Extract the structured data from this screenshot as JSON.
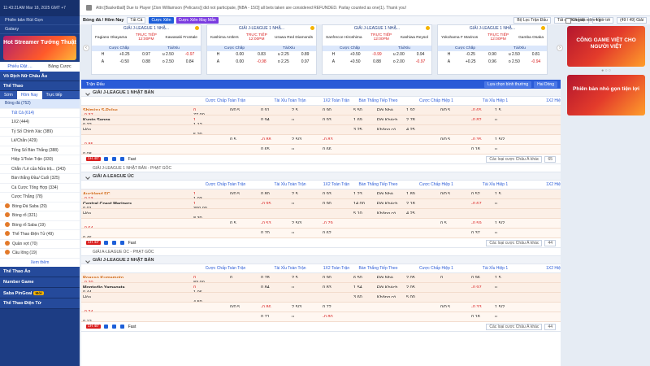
{
  "clock": "11:43:21AM Mar 18, 2025 GMT +7",
  "ticker": "Attn:[Basketball] Due to Player [Zion Williamson (Pelicans)] did not participate, [NBA - 15/3] all bets taken are considered REFUNDED. Parlay counted as one(1). Thank you!",
  "left": {
    "btn1": "Phiên bản Rút Gọn",
    "btn2": "Galaxy",
    "banner": "Hot Streamer Tướng Thuật",
    "tabs": [
      "Phiếu Đặt ...",
      "Bảng Cược"
    ],
    "sec_champions": "Vô Địch Nữ Châu Âu",
    "sec_sports": "Thể Thao",
    "subtabs": [
      "Sớm",
      "Hôm Nay",
      "Trực tiếp"
    ],
    "soccer": "Bóng đá (752)",
    "items": [
      "Tất Cả (614)",
      "1X2 (444)",
      "Tỷ Số Chính Xác (389)",
      "Lẻ/Chẵn (429)",
      "Tổng Số Bàn Thắng (388)",
      "Hiệp 1/Toàn Trận (330)",
      "Chẵn / Lẻ của Nửa trậ... (343)",
      "Bàn thắng Đầu/ Cuối (325)",
      "Cá Cược Tổng Hợp (334)",
      "Cược Thắng (78)"
    ],
    "sports": [
      "Bóng Đá Saba (29)",
      "Bóng rổ (321)",
      "Bóng rổ Saba (19)",
      "Thể Thao Điện Tử (49)",
      "Quần vợt (70)",
      "Cầu lông (19)"
    ],
    "more": "Xem thêm",
    "bottom": [
      "Thể Thao Ảo",
      "Number Game",
      "Saba PinGoal",
      "Thể Thao Điện Tử"
    ],
    "new_badge": "Mới"
  },
  "filter": {
    "title": "Bóng đá / Hôm Nay",
    "all": "Tất Cả",
    "btn_cx": "Cược Xiên",
    "btn_may": "Cược Xiên May Mắn",
    "sort": "Bộ Lọc Trận Đấu",
    "time": "Tất cả thời gian",
    "hours": "4 giờ tới",
    "count": "(49 / 49) Giải"
  },
  "cards": [
    {
      "league": "GIẢI J-LEAGUE 1 NHẬ...",
      "home": "Fagiano Okayama",
      "status": "TRỰC TIẾP",
      "time": "12:00PM",
      "away": "Kawasaki Frontale",
      "h1": [
        "H",
        "+0.25",
        "0.97",
        "u 2.50",
        "-0.97"
      ],
      "h2": [
        "A",
        "-0.50",
        "0.88",
        "o 2.50",
        "0.84"
      ]
    },
    {
      "league": "GIẢI J-LEAGUE 1 NHẬ...",
      "home": "Kashima Antlers",
      "status": "TRỰC TIẾP",
      "time": "12:00PM",
      "away": "Urawa Red Diamonds",
      "h1": [
        "H",
        "0.00",
        "0.83",
        "u 2.25",
        "0.89"
      ],
      "h2": [
        "A",
        "0.00",
        "-0.98",
        "o 2.25",
        "0.97"
      ]
    },
    {
      "league": "GIẢI J-LEAGUE 1 NHẬ...",
      "home": "Sanfrecce Hiroshima",
      "status": "TRỰC TIẾP",
      "time": "12:00PM",
      "away": "Kashiwa Reysol",
      "h1": [
        "H",
        "+0.50",
        "-0.99",
        "u 2.00",
        "0.94"
      ],
      "h2": [
        "A",
        "+0.50",
        "0.88",
        "o 2.00",
        "-0.97"
      ]
    },
    {
      "league": "GIẢI J-LEAGUE 1 NHẬ...",
      "home": "Yokohama F Marinos",
      "status": "TRỰC TIẾP",
      "time": "12:00PM",
      "away": "Gamba Osaka",
      "h1": [
        "H",
        "-0.25",
        "0.90",
        "u 2.50",
        "0.81"
      ],
      "h2": [
        "A",
        "+0.25",
        "0.96",
        "o 2.50",
        "-0.94"
      ]
    }
  ],
  "card_hdr": [
    "Cược Chấp",
    "Tài/Xỉu"
  ],
  "right": {
    "chk": "Chế độ niêm tối",
    "ad1": "CÔNG GAME VIỆT CHO NGƯỜI VIỆT",
    "ad2": "Phiên bản nhỏ gọn tiện lợi"
  },
  "main": {
    "title": "Trận Đấu",
    "btn_sort": "Lựa chọn bình thường",
    "btn_odds": "Hai Dòng"
  },
  "cols": [
    "",
    "",
    "Cược Chấp Toàn Trận",
    "",
    "Tài Xỉu Toàn Trận",
    "",
    "1X2 Toàn Trận",
    "Bàn Thắng Tiếp Theo",
    "",
    "Cược Chấp Hiệp 1",
    "",
    "Tài Xỉu Hiệp 1",
    "",
    "1X2 Hiệp 1"
  ],
  "blocks": [
    {
      "league": "GIẢI J-LEAGUE 1 NHẬT BẢN",
      "home": "Shimizu S-Pulse",
      "away": "Kyoto Sanga",
      "draw": "Hòa",
      "hs": "0",
      "as": "1",
      "r1": [
        "0/0.5",
        "0.91",
        "2.5",
        "0.90",
        "5.50",
        "Đội Nhà",
        "1.92",
        "0/0.5",
        "-0.65",
        "1.5",
        "-0.37",
        "77.00"
      ],
      "r2": [
        "",
        "0.94",
        "u",
        "0.93",
        "1.69",
        "Đội Khách",
        "2.78",
        "",
        "-0.82",
        "u",
        "0.22",
        "1.12"
      ],
      "r3": [
        "",
        "",
        "",
        "",
        "3.25",
        "Không có",
        "4.25",
        "",
        "",
        "",
        "",
        "5.20"
      ],
      "r4": [
        "0.5",
        "-0.88",
        "2.5/3",
        "-0.83",
        "",
        "",
        "",
        "0/0.5",
        "-0.35",
        "1.5/2",
        "-0.85",
        ""
      ],
      "r5": [
        "",
        "0.65",
        "u",
        "0.66",
        "",
        "",
        "",
        "",
        "0.18",
        "u",
        "0.08",
        ""
      ],
      "live": "1H 40'",
      "foot": "Fast",
      "more": "Các loại cược Châu Á khác",
      "n": "65"
    },
    {
      "league": "GIẢI A-LEAGUE ÚC",
      "home": "Auckland FC",
      "away": "Central Coast Mariners",
      "draw": "Hòa",
      "hs": "1",
      "as": "1",
      "r1": [
        "0/0.5",
        "0.80",
        "2.5",
        "0.93",
        "1.23",
        "Đội Nhà",
        "1.89",
        "0/0.5",
        "0.52",
        "1.5",
        "-0.13",
        "1.03"
      ],
      "r2": [
        "",
        "-0.95",
        "u",
        "0.90",
        "14.00",
        "Đội Khách",
        "2.18",
        "",
        "-0.67",
        "u",
        "0.01",
        "300.00"
      ],
      "r3": [
        "",
        "",
        "",
        "",
        "5.10",
        "Không có",
        "4.25",
        "",
        "",
        "",
        "",
        "8.30"
      ],
      "r4": [
        "0.5",
        "-0.53",
        "2.5/3",
        "-0.79",
        "",
        "",
        "",
        "0.5",
        "-0.59",
        "1.5/2",
        "-0.64",
        ""
      ],
      "r5": [
        "",
        "0.70",
        "u",
        "0.62",
        "",
        "",
        "",
        "",
        "0.37",
        "u",
        "0.46",
        ""
      ],
      "live": "1H 43'",
      "foot": "Fast",
      "more": "Các loại cược Châu Á khác",
      "n": "44"
    },
    {
      "league": "GIẢI J-LEAGUE 2 NHẬT BẢN",
      "home": "Roasso Kumamoto",
      "away": "Montedio Yamagata",
      "draw": "Hòa",
      "hs": "0",
      "as": "0",
      "r1": [
        "0",
        "0.78",
        "2.5",
        "0.90",
        "6.50",
        "Đội Nhà",
        "2.05",
        "0",
        "0.96",
        "1.5",
        "-0.70",
        "83.00"
      ],
      "r2": [
        "",
        "0.84",
        "u",
        "0.83",
        "1.54",
        "Đội Khách",
        "2.05",
        "",
        "-0.97",
        "u",
        "0.44",
        "1.06"
      ],
      "r3": [
        "",
        "",
        "",
        "",
        "3.60",
        "Không có",
        "5.00",
        "",
        "",
        "",
        "",
        "4.50"
      ],
      "r4": [
        "0/0.5",
        "-0.86",
        "2.5/3",
        "0.72",
        "",
        "",
        "",
        "0/0.5",
        "-0.33",
        "1.5/2",
        "-0.24",
        ""
      ],
      "r5": [
        "",
        "0.71",
        "u",
        "-0.80",
        "",
        "",
        "",
        "",
        "0.18",
        "u",
        "0.12",
        ""
      ],
      "live": "1H 40'",
      "foot": "Fast",
      "more": "Các loại cược Châu Á khác",
      "n": "44"
    }
  ],
  "sub1": "GIẢI J-LEAGUE 1 NHẬT BẢN - PHẠT GÓC",
  "sub2": "GIẢI A-LEAGUE ÚC - PHẠT GÓC"
}
